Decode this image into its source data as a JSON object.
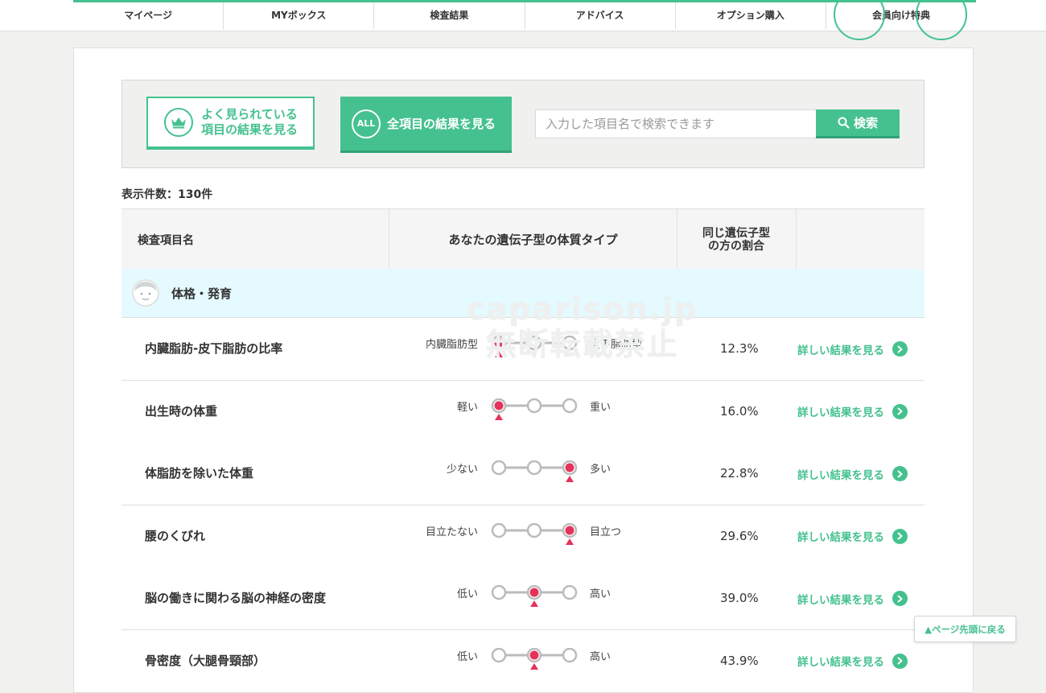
{
  "nav": {
    "items": [
      {
        "label": "マイページ"
      },
      {
        "label": "MYボックス"
      },
      {
        "label": "検査結果"
      },
      {
        "label": "アドバイス"
      },
      {
        "label": "オプション購入"
      },
      {
        "label": "会員向け特典"
      }
    ]
  },
  "colors": {
    "accent": "#45c18f",
    "marker": "#e4335a",
    "category_bg": "#e4fafe"
  },
  "search": {
    "popular_line1": "よく見られている",
    "popular_line2": "項目の結果を見る",
    "all_badge": "ALL",
    "all_label": "全項目の結果を見る",
    "placeholder": "入力した項目名で検索できます",
    "button_label": "検索"
  },
  "count_label": "表示件数：130件",
  "table": {
    "headers": {
      "item": "検査項目名",
      "type": "あなたの遺伝子型の体質タイプ",
      "ratio_line1": "同じ遺伝子型",
      "ratio_line2": "の方の割合"
    },
    "category": "体格・発育",
    "detail_label": "詳しい結果を見る",
    "rows": [
      {
        "name": "内臓脂肪-皮下脂肪の比率",
        "left": "内臓脂肪型",
        "right": "皮下脂肪型",
        "position": 0,
        "ratio": "12.3%"
      },
      {
        "name": "出生時の体重",
        "left": "軽い",
        "right": "重い",
        "position": 0,
        "ratio": "16.0%"
      },
      {
        "name": "体脂肪を除いた体重",
        "left": "少ない",
        "right": "多い",
        "position": 2,
        "ratio": "22.8%"
      },
      {
        "name": "腰のくびれ",
        "left": "目立たない",
        "right": "目立つ",
        "position": 2,
        "ratio": "29.6%"
      },
      {
        "name": "脳の働きに関わる脳の神経の密度",
        "left": "低い",
        "right": "高い",
        "position": 1,
        "ratio": "39.0%"
      },
      {
        "name": "骨密度（大腿骨頸部）",
        "left": "低い",
        "right": "高い",
        "position": 1,
        "ratio": "43.9%"
      }
    ]
  },
  "watermark": {
    "line1": "caparison.jp",
    "line2": "無断転載禁止"
  },
  "back_to_top": "▲ページ先頭に戻る"
}
